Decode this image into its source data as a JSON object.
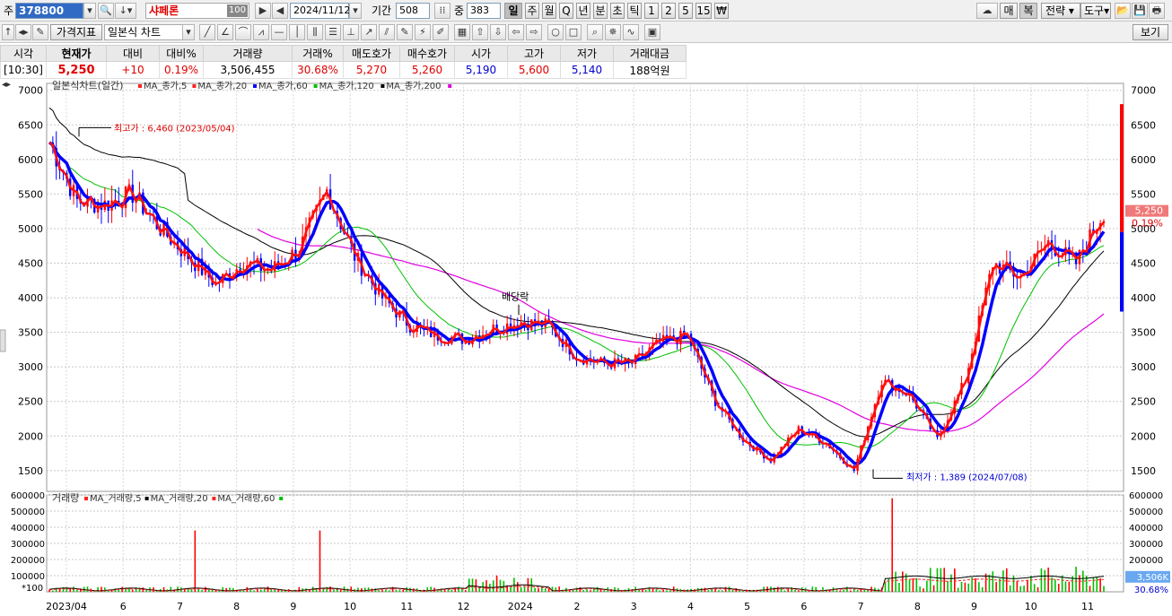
{
  "toolbar": {
    "market_label": "주",
    "stock_code": "378800",
    "stock_name": "샤페론",
    "name_badge": "100",
    "date": "2024/11/12",
    "period_label": "기간",
    "period_value": "508",
    "overlap_label": "중",
    "overlap_value": "383",
    "timeframes": [
      "일",
      "주",
      "월",
      "Q",
      "년",
      "분",
      "초",
      "틱",
      "1",
      "2",
      "5",
      "15",
      "₩"
    ],
    "selected_timeframe": "일",
    "right_buttons": [
      "매",
      "복",
      "전략",
      "도구"
    ],
    "selected_right": "복",
    "chart_menu_1": "가격지표",
    "chart_menu_2": "일본식 차트",
    "view_button": "보기"
  },
  "quote": {
    "headers": [
      "시각",
      "현재가",
      "대비",
      "대비%",
      "거래량",
      "거래%",
      "매도호가",
      "매수호가",
      "시가",
      "고가",
      "저가",
      "거래대금"
    ],
    "values": [
      "[10:30]",
      "5,250",
      "+10",
      "0.19%",
      "3,506,455",
      "30.68%",
      "5,270",
      "5,260",
      "5,190",
      "5,600",
      "5,140",
      "188억원"
    ]
  },
  "chart_data": {
    "type": "candlestick",
    "price_legend": {
      "title": "일본식차트(일간)",
      "series": [
        {
          "name": "MA_종가,5",
          "color": "#ff2020"
        },
        {
          "name": "MA_종가,20",
          "color": "#ff2020"
        },
        {
          "name": "MA_종가,60",
          "color": "#0000ff"
        },
        {
          "name": "MA_종가,120",
          "color": "#00c000"
        },
        {
          "name": "MA_종가,200",
          "color": "#000000"
        },
        {
          "name": "",
          "color": "#e000e0"
        }
      ]
    },
    "volume_legend": {
      "title": "거래량",
      "series": [
        {
          "name": "MA_거래량,5",
          "color": "#ff2020"
        },
        {
          "name": "MA_거래량,20",
          "color": "#000000"
        },
        {
          "name": "MA_거래량,60",
          "color": "#ff2020"
        },
        {
          "name": "",
          "color": "#00c000"
        }
      ]
    },
    "x_ticks": [
      "2023/04",
      "6",
      "7",
      "8",
      "9",
      "10",
      "11",
      "12",
      "2024",
      "2",
      "3",
      "4",
      "5",
      "6",
      "7",
      "8",
      "9",
      "10",
      "11"
    ],
    "y_ticks": [
      7000,
      6500,
      6000,
      5500,
      5000,
      4500,
      4000,
      3500,
      3000,
      2500,
      2000,
      1500
    ],
    "ylim": [
      1200,
      7100
    ],
    "volume_ticks": [
      600000,
      500000,
      400000,
      300000,
      200000,
      100000
    ],
    "volume_unit": "*100",
    "volume_ylim": [
      0,
      600000
    ],
    "current_price_label": "5,250",
    "current_change_label": "0.19%",
    "current_volume_label": "3,506K",
    "current_volume_pct_label": "30.68%",
    "annotations": {
      "high": "최고가 : 6,460 (2023/05/04)",
      "low": "최저가 : 1,389 (2024/07/08)",
      "event": "배당락"
    },
    "close_series": [
      {
        "x": "2023/04",
        "y": 6250
      },
      {
        "x": "2023/05",
        "y": 5400
      },
      {
        "x": "2023/05-b",
        "y": 5350
      },
      {
        "x": "2023/06",
        "y": 5500
      },
      {
        "x": "2023/06-b",
        "y": 5000
      },
      {
        "x": "2023/07",
        "y": 4600
      },
      {
        "x": "2023/07-b",
        "y": 4200
      },
      {
        "x": "2023/08",
        "y": 4500
      },
      {
        "x": "2023/08-b",
        "y": 4400
      },
      {
        "x": "2023/09",
        "y": 4700
      },
      {
        "x": "2023/09-b",
        "y": 5550
      },
      {
        "x": "2023/10",
        "y": 4600
      },
      {
        "x": "2023/10-b",
        "y": 4000
      },
      {
        "x": "2023/11",
        "y": 3600
      },
      {
        "x": "2023/11-b",
        "y": 3450
      },
      {
        "x": "2023/12",
        "y": 3400
      },
      {
        "x": "2023/12-b",
        "y": 3550
      },
      {
        "x": "2024/01",
        "y": 3650
      },
      {
        "x": "2024/01-b",
        "y": 3600
      },
      {
        "x": "2024/02",
        "y": 3150
      },
      {
        "x": "2024/02-b",
        "y": 3050
      },
      {
        "x": "2024/03",
        "y": 3050
      },
      {
        "x": "2024/03-b",
        "y": 3350
      },
      {
        "x": "2024/04",
        "y": 3450
      },
      {
        "x": "2024/04-b",
        "y": 2500
      },
      {
        "x": "2024/05",
        "y": 1950
      },
      {
        "x": "2024/05-b",
        "y": 1650
      },
      {
        "x": "2024/06",
        "y": 2100
      },
      {
        "x": "2024/06-b",
        "y": 1900
      },
      {
        "x": "2024/07",
        "y": 1500
      },
      {
        "x": "2024/07-b",
        "y": 2800
      },
      {
        "x": "2024/08",
        "y": 2600
      },
      {
        "x": "2024/08-b",
        "y": 1950
      },
      {
        "x": "2024/09",
        "y": 2800
      },
      {
        "x": "2024/09-b",
        "y": 4500
      },
      {
        "x": "2024/10",
        "y": 4300
      },
      {
        "x": "2024/10-b",
        "y": 4800
      },
      {
        "x": "2024/11",
        "y": 4500
      },
      {
        "x": "2024/11-b",
        "y": 5250
      }
    ]
  }
}
